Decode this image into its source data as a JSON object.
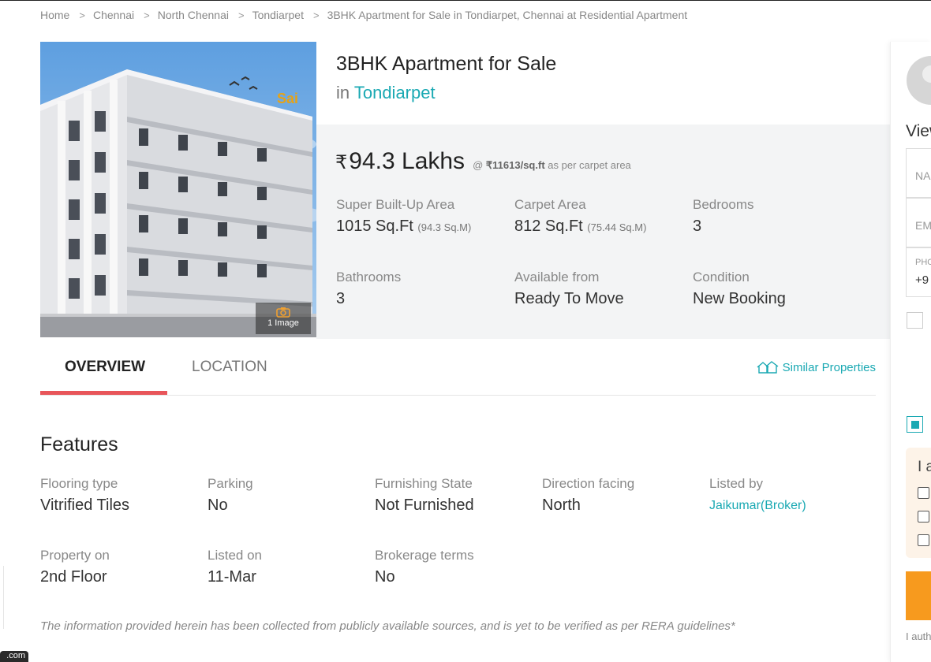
{
  "breadcrumb": [
    "Home",
    "Chennai",
    "North Chennai",
    "Tondiarpet",
    "3BHK Apartment for Sale in Tondiarpet, Chennai at Residential Apartment"
  ],
  "breadcrumb_sep": ">",
  "photo": {
    "count_label": "1 Image",
    "sign_text": "Sai"
  },
  "listing": {
    "title": "3BHK Apartment for Sale",
    "in_text": "in",
    "locality": "Tondiarpet"
  },
  "price": {
    "currency": "₹",
    "amount": "94.3 Lakhs",
    "at": "@",
    "rate": "₹11613/sq.ft",
    "rate_note": "as per carpet area"
  },
  "specs": {
    "super_area": {
      "label": "Super Built-Up Area",
      "value": "1015 Sq.Ft",
      "sub": "(94.3 Sq.M)"
    },
    "carpet_area": {
      "label": "Carpet Area",
      "value": "812 Sq.Ft",
      "sub": "(75.44 Sq.M)"
    },
    "bedrooms": {
      "label": "Bedrooms",
      "value": "3"
    },
    "bathrooms": {
      "label": "Bathrooms",
      "value": "3"
    },
    "available": {
      "label": "Available from",
      "value": "Ready To Move"
    },
    "condition": {
      "label": "Condition",
      "value": "New Booking"
    }
  },
  "tabs": {
    "overview": "OVERVIEW",
    "location": "LOCATION",
    "similar": "Similar Properties"
  },
  "features": {
    "title": "Features",
    "flooring": {
      "label": "Flooring type",
      "value": "Vitrified Tiles"
    },
    "parking": {
      "label": "Parking",
      "value": "No"
    },
    "furnishing": {
      "label": "Furnishing State",
      "value": "Not Furnished"
    },
    "direction": {
      "label": "Direction facing",
      "value": "North"
    },
    "listed_by": {
      "label": "Listed by",
      "value": "Jaikumar(Broker)"
    },
    "property_on": {
      "label": "Property on",
      "value": "2nd Floor"
    },
    "listed_on": {
      "label": "Listed on",
      "value": "11-Mar"
    },
    "brokerage": {
      "label": "Brokerage terms",
      "value": "No"
    }
  },
  "disclaimer": "The information provided herein has been collected from publicly available sources, and is yet to be verified as per RERA guidelines*",
  "side_panel": {
    "heading": "View",
    "name_placeholder": "NA",
    "email_placeholder": "EM",
    "phone_label": "PHO",
    "phone_prefix": "+9",
    "box_text": "I a",
    "auth_text": "I auth"
  },
  "chat_tab": ".com",
  "colors": {
    "accent": "#1aa9b3",
    "tab_underline": "#e8555a",
    "cta": "#f79a1e",
    "panel_bg": "#f3f4f5"
  }
}
